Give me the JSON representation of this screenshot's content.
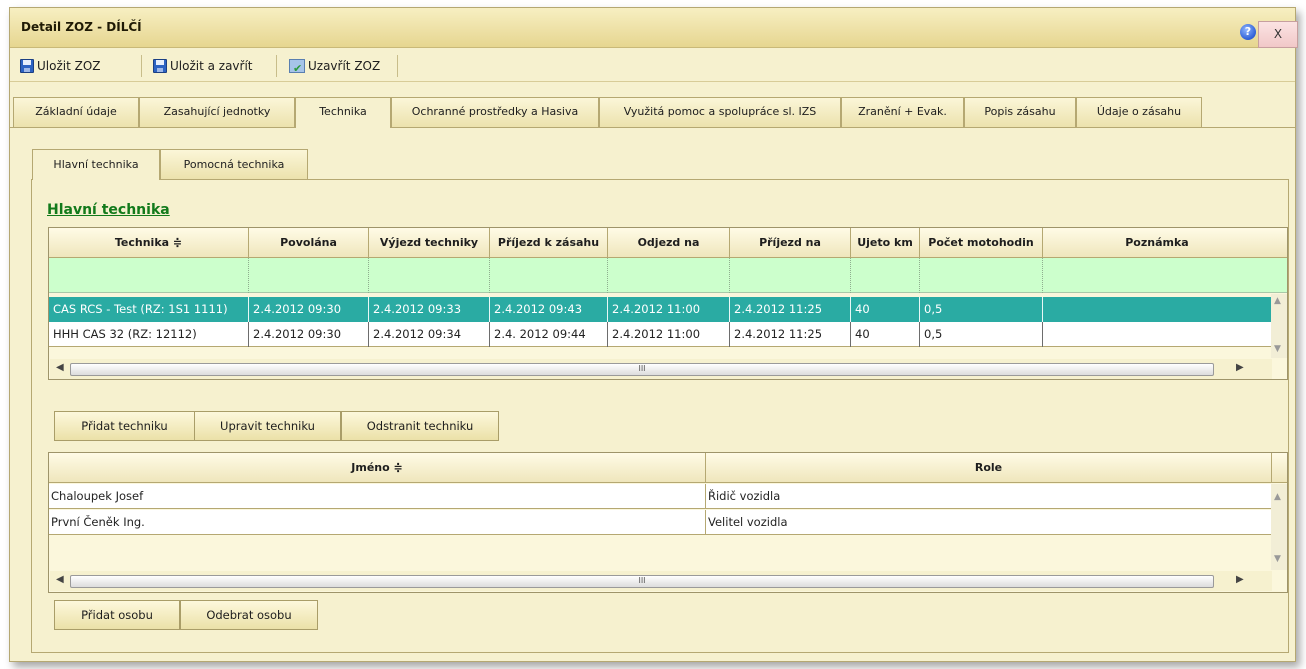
{
  "window": {
    "title": "Detail ZOZ - DÍLČÍ",
    "help_glyph": "?",
    "close_label": "X"
  },
  "toolbar": {
    "save": "Uložit ZOZ",
    "save_close": "Uložit a zavřít",
    "close_zoz": "Uzavřít ZOZ"
  },
  "tabs": [
    "Základní údaje",
    "Zasahující jednotky",
    "Technika",
    "Ochranné prostředky a Hasiva",
    "Využitá pomoc a spolupráce sl. IZS",
    "Zranění + Evak.",
    "Popis zásahu",
    "Údaje o zásahu"
  ],
  "active_tab": "Technika",
  "subtabs": [
    "Hlavní technika",
    "Pomocná technika"
  ],
  "section_title": "Hlavní technika",
  "vehicle_grid": {
    "columns": [
      "Technika",
      "Povolána",
      "Výjezd techniky",
      "Příjezd k zásahu",
      "Odjezd na základnu",
      "Příjezd na základnu",
      "Ujeto km",
      "Počet motohodin",
      "Poznámka"
    ],
    "sort_glyph": "≑",
    "rows": [
      [
        "CAS RCS - Test (RZ: 1S1 1111)",
        "2.4.2012 09:30",
        "2.4.2012 09:33",
        "2.4.2012 09:43",
        "2.4.2012 11:00",
        "2.4.2012 11:25",
        "40",
        "0,5",
        ""
      ],
      [
        "HHH CAS 32 (RZ: 12112)",
        "2.4.2012 09:30",
        "2.4.2012 09:34",
        "2.4. 2012 09:44",
        "2.4.2012 11:00",
        "2.4.2012 11:25",
        "40",
        "0,5",
        ""
      ]
    ],
    "buttons": [
      "Přidat techniku",
      "Upravit techniku",
      "Odstranit techniku"
    ]
  },
  "crew_grid": {
    "columns": [
      "Jméno",
      "Role"
    ],
    "rows": [
      [
        "Chaloupek Josef",
        "Řidič vozidla"
      ],
      [
        "První Čeněk Ing.",
        "Velitel vozidla"
      ]
    ],
    "buttons": [
      "Přidat osobu",
      "Odebrat osobu"
    ]
  },
  "scroll_thumb_glyph": "III",
  "colors": {
    "selected_row": "#2aaba3",
    "filter_row": "#ccffcc",
    "section_title": "#127a1b",
    "panel_bg": "#f6f1cf"
  }
}
